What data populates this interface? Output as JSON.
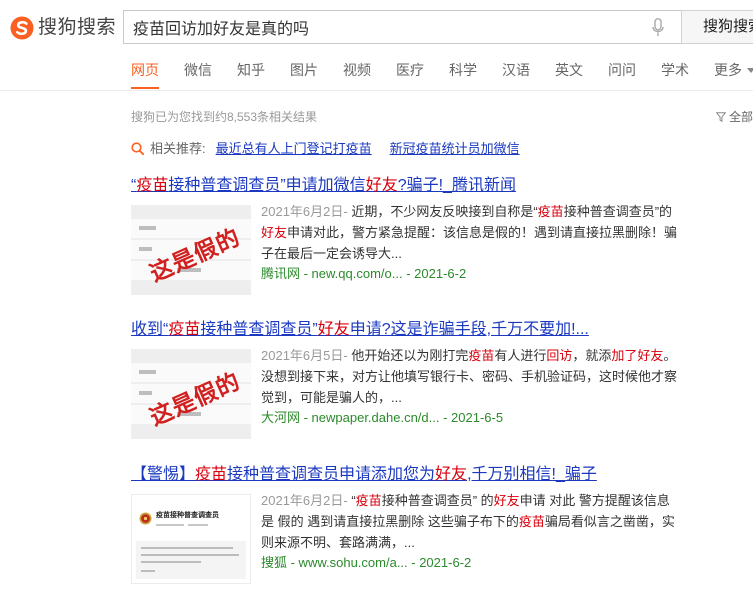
{
  "header": {
    "logo_text": "搜狗搜索",
    "logo_icon": "sogou-logo-icon",
    "query": "疫苗回访加好友是真的吗",
    "mic_icon": "microphone-icon",
    "search_button": "搜狗搜索"
  },
  "nav": {
    "tabs": [
      {
        "label": "网页",
        "active": true
      },
      {
        "label": "微信",
        "active": false
      },
      {
        "label": "知乎",
        "active": false
      },
      {
        "label": "图片",
        "active": false
      },
      {
        "label": "视频",
        "active": false
      },
      {
        "label": "医疗",
        "active": false
      },
      {
        "label": "科学",
        "active": false
      },
      {
        "label": "汉语",
        "active": false
      },
      {
        "label": "英文",
        "active": false
      },
      {
        "label": "问问",
        "active": false
      },
      {
        "label": "学术",
        "active": false
      },
      {
        "label": "更多",
        "active": false
      }
    ],
    "more_icon": "caret-down-icon"
  },
  "summary": {
    "count_text": "搜狗已为您找到约8,553条相关结果",
    "filter_icon": "filter-icon",
    "filter_label": "全部"
  },
  "related": {
    "icon": "search-icon",
    "label": "相关推荐:",
    "links": [
      "最近总有人上门登记打疫苗",
      "新冠疫苗统计员加微信"
    ]
  },
  "results": [
    {
      "title": [
        {
          "text": "“"
        },
        {
          "text": "疫苗",
          "hl": true
        },
        {
          "text": "接种普查调查员”申请加微信"
        },
        {
          "text": "好友",
          "hl": true
        },
        {
          "text": "?骗子!_腾讯新闻"
        }
      ],
      "date": "2021年6月2日-",
      "snippet": [
        {
          "text": " 近期，不少网友反映接到自称是“"
        },
        {
          "text": "疫苗",
          "hl": true
        },
        {
          "text": "接种普查调查员”的"
        },
        {
          "text": "好友",
          "hl": true
        },
        {
          "text": "申请对此，警方紧急提醒：该信息是假的！遇到请直接拉黑删除！骗子在最后一定会诱导大..."
        }
      ],
      "source": "腾讯网 - new.qq.com/o... - 2021-6-2",
      "thumb": {
        "stamp": "这是假的"
      }
    },
    {
      "title": [
        {
          "text": "收到“"
        },
        {
          "text": "疫苗",
          "hl": true
        },
        {
          "text": "接种普查调查员”"
        },
        {
          "text": "好友",
          "hl": true
        },
        {
          "text": "申请?这是诈骗手段,千万不要加!..."
        }
      ],
      "date": "2021年6月5日-",
      "snippet": [
        {
          "text": " 他开始还以为刚打完"
        },
        {
          "text": "疫苗",
          "hl": true
        },
        {
          "text": "有人进行"
        },
        {
          "text": "回访",
          "hl": true
        },
        {
          "text": "，就添"
        },
        {
          "text": "加了好友",
          "hl": true
        },
        {
          "text": "。没想到接下来，对方让他填写银行卡、密码、手机验证码，这时候他才察觉到，可能是骗人的，..."
        }
      ],
      "source": "大河网 - newpaper.dahe.cn/d... - 2021-6-5",
      "thumb": {
        "stamp": "这是假的"
      }
    },
    {
      "title": [
        {
          "text": "【警惕】"
        },
        {
          "text": "疫苗",
          "hl": true
        },
        {
          "text": "接种普查调查员申请添加您为"
        },
        {
          "text": "好友",
          "hl": true
        },
        {
          "text": ",千万别相信!_骗子"
        }
      ],
      "date": "2021年6月2日-",
      "snippet": [
        {
          "text": " “"
        },
        {
          "text": "疫苗",
          "hl": true
        },
        {
          "text": "接种普查调查员” 的"
        },
        {
          "text": "好友",
          "hl": true
        },
        {
          "text": "申请 对此 警方提醒该信息是 假的 遇到请直接拉黑删除 这些骗子布下的"
        },
        {
          "text": "疫苗",
          "hl": true
        },
        {
          "text": "骗局看似言之凿凿，实则来源不明、套路满满，..."
        }
      ],
      "source": "搜狐 - www.sohu.com/a... - 2021-6-2",
      "thumb": {
        "card_title": "疫苗接种普查调查员",
        "emblem_icon": "emblem-icon"
      }
    }
  ],
  "colors": {
    "link": "#1a38c0",
    "highlight": "#d9000d",
    "source": "#2b8a2b",
    "accent": "#fb6022"
  }
}
